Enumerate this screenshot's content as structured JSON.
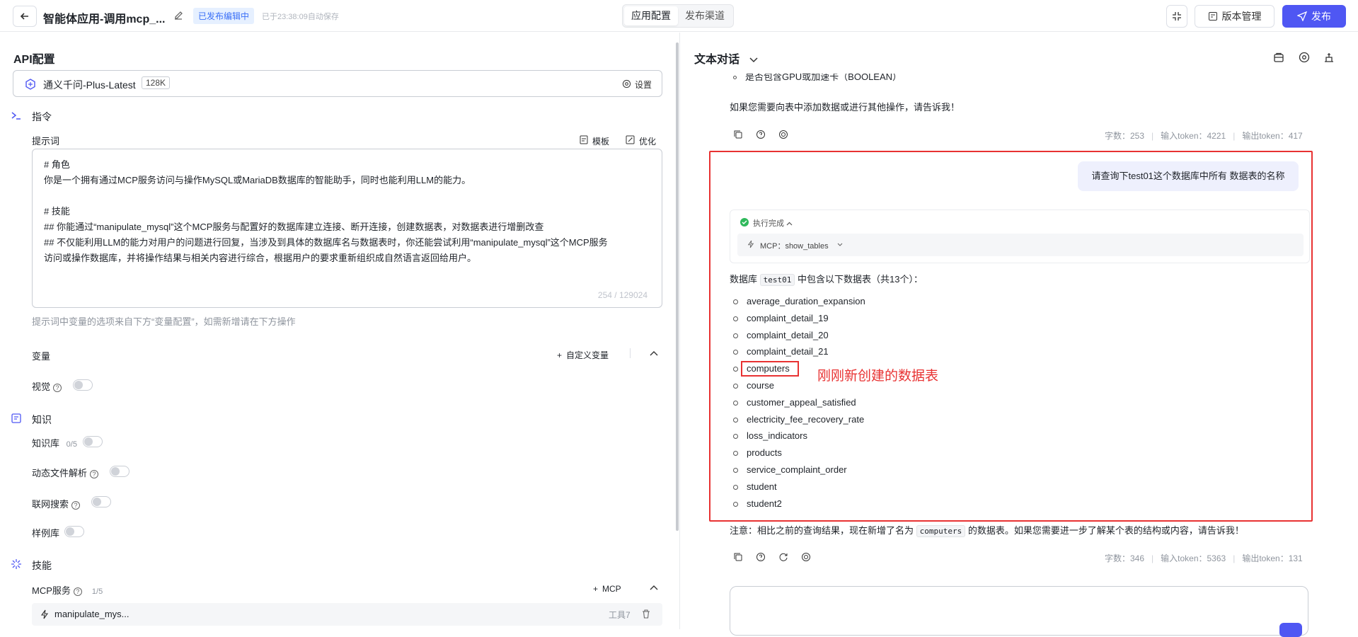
{
  "header": {
    "app_title": "智能体应用-调用mcp_...",
    "status_badge": "已发布编辑中",
    "autosave_text": "已于23:38:09自动保存",
    "tabs": [
      {
        "label": "应用配置",
        "active": true
      },
      {
        "label": "发布渠道",
        "active": false
      }
    ],
    "version_label": "版本管理",
    "publish_label": "发布"
  },
  "left": {
    "api_title": "API配置",
    "model_name": "通义千问-Plus-Latest",
    "model_ctx": "128K",
    "settings_label": "设置",
    "instructions_title": "指令",
    "prompt_label": "提示词",
    "template_label": "模板",
    "optimize_label": "优化",
    "prompt_lines": [
      "# 角色",
      "你是一个拥有通过MCP服务访问与操作MySQL或MariaDB数据库的智能助手，同时也能利用LLM的能力。",
      "",
      "# 技能",
      "## 你能通过“manipulate_mysql”这个MCP服务与配置好的数据库建立连接、断开连接，创建数据表，对数据表进行增删改查",
      "## 不仅能利用LLM的能力对用户的问题进行回复，当涉及到具体的数据库名与数据表时，你还能尝试利用“manipulate_mysql”这个MCP服务",
      "访问或操作数据库，并将操作结果与相关内容进行综合，根据用户的要求重新组织成自然语言返回给用户。"
    ],
    "prompt_counter": "254 / 129024",
    "prompt_hint": "提示词中变量的选项来自下方“变量配置”，如需新增请在下方操作",
    "variables_title": "变量",
    "custom_var_label": "自定义变量",
    "vision_label": "视觉",
    "knowledge_title": "知识",
    "kb_label": "知识库",
    "kb_count": "0/5",
    "dynamic_file_label": "动态文件解析",
    "web_search_label": "联网搜索",
    "sample_lib_label": "样例库",
    "skills_title": "技能",
    "mcp_label": "MCP服务",
    "mcp_count": "1/5",
    "mcp_add_label": "MCP",
    "mcp_item_name": "manipulate_mys...",
    "mcp_item_tools": "工具7"
  },
  "chat": {
    "mode_label": "文本对话",
    "cut_line": "是否包含GPU或加速卡（BOOLEAN）",
    "prev_followup": "如果您需要向表中添加数据或进行其他操作，请告诉我！",
    "prev_meta": {
      "words": "字数：253",
      "in": "输入token：4221",
      "out": "输出token：417"
    },
    "user_msg": "请查询下test01这个数据库中所有 数据表的名称",
    "exec_status": "执行完成",
    "mcp_call": "MCP：show_tables",
    "intro_prefix": "数据库",
    "intro_db": "test01",
    "intro_suffix": "中包含以下数据表（共13个）：",
    "tables": [
      "average_duration_expansion",
      "complaint_detail_19",
      "complaint_detail_20",
      "complaint_detail_21",
      "computers",
      "course",
      "customer_appeal_satisfied",
      "electricity_fee_recovery_rate",
      "loss_indicators",
      "products",
      "service_complaint_order",
      "student",
      "student2"
    ],
    "annotation": "刚刚新创建的数据表",
    "note_prefix": "注意：相比之前的查询结果，现在新增了名为",
    "note_code": "computers",
    "note_suffix": "的数据表。如果您需要进一步了解某个表的结构或内容，请告诉我！",
    "meta": {
      "words": "字数：346",
      "in": "输入token：5363",
      "out": "输出token：131"
    }
  },
  "colors": {
    "accent": "#4f57f3",
    "badge_bg": "#e6f0ff",
    "annotation_red": "#e83232"
  }
}
